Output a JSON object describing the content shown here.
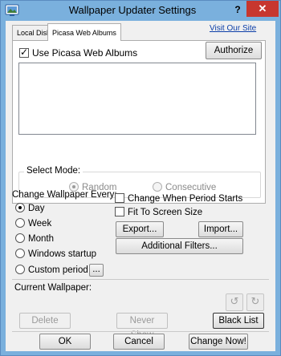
{
  "window": {
    "title": "Wallpaper Updater Settings",
    "help_label": "?",
    "close_label": "✕",
    "accent_color": "#7ab0dd"
  },
  "tabs": [
    {
      "label": "Local Disk",
      "active": false
    },
    {
      "label": "Picasa Web Albums",
      "active": true
    }
  ],
  "visit_link": "Visit Our Site",
  "picasa": {
    "use_label": "Use Picasa Web Albums",
    "use_checked": true,
    "authorize_label": "Authorize",
    "select_mode_label": "Select Mode:",
    "modes": [
      {
        "label": "Random",
        "selected": true
      },
      {
        "label": "Consecutive",
        "selected": false
      }
    ]
  },
  "change_every": {
    "label": "Change Wallpaper Every:",
    "options": [
      {
        "label": "Day",
        "selected": true
      },
      {
        "label": "Week",
        "selected": false
      },
      {
        "label": "Month",
        "selected": false
      },
      {
        "label": "Windows startup",
        "selected": false
      },
      {
        "label": "Custom period",
        "selected": false
      }
    ],
    "custom_browse_label": "..."
  },
  "options": {
    "change_when_period_starts_label": "Change When Period Starts",
    "change_when_period_starts_checked": false,
    "fit_to_screen_label": "Fit To Screen Size",
    "fit_to_screen_checked": false
  },
  "actions": {
    "export_label": "Export...",
    "import_label": "Import...",
    "filters_label": "Additional Filters..."
  },
  "current": {
    "label": "Current Wallpaper:",
    "rotate_left_icon": "rotate-left-icon",
    "rotate_right_icon": "rotate-right-icon",
    "delete_label": "Delete",
    "never_show_label": "Never Show",
    "blacklist_label": "Black List"
  },
  "footer": {
    "ok_label": "OK",
    "cancel_label": "Cancel",
    "change_now_label": "Change Now!"
  }
}
